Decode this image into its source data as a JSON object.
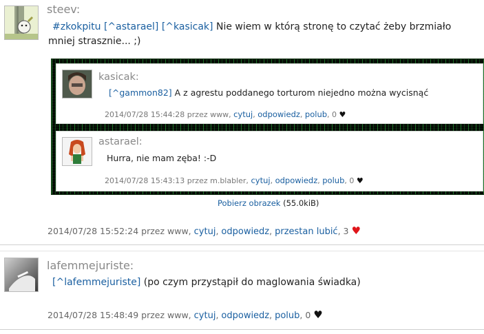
{
  "posts": [
    {
      "author": "steev:",
      "text_parts": {
        "hashtag": "#zkokpitu",
        "mention1": "[^astarael]",
        "mention2": "[^kasicak]",
        "body": " Nie wiem w którą stronę to czytać żeby brzmiało mniej strasznie... ;)"
      },
      "meta": {
        "timestamp": "2014/07/28 15:52:24",
        "via": "przez www,",
        "quote": "cytuj",
        "reply": "odpowiedz",
        "like": "przestan lubić",
        "likes": "3",
        "heart": "♥"
      }
    },
    {
      "author": "lafemmejuriste:",
      "text_parts": {
        "mention": "[^lafemmejuriste]",
        "body": " (po czym przystąpił do maglowania świadka)"
      },
      "meta": {
        "timestamp": "2014/07/28 15:48:49",
        "via": "przez www,",
        "quote": "cytuj",
        "reply": "odpowiedz",
        "like": "polub",
        "likes": "0",
        "heart": "♥"
      }
    }
  ],
  "embedded": {
    "cards": [
      {
        "author": "kasicak:",
        "mention": "[^gammon82]",
        "body": " A z agrestu poddanego torturom niejedno można wycisnąć",
        "meta_prefix": "2014/07/28 15:44:28 przez www,",
        "quote": "cytuj",
        "reply": "odpowiedz",
        "like": "polub",
        "likes": "0",
        "heart": "♥"
      },
      {
        "author": "astarael:",
        "body": "Hurra, nie mam zęba! :-D",
        "meta_prefix": "2014/07/28 15:43:13 przez m.blabler,",
        "quote": "cytuj",
        "reply": "odpowiedz",
        "like": "polub",
        "likes": "0",
        "heart": "♥"
      }
    ],
    "download_label": "Pobierz obrazek",
    "download_size": "(55.0kiB)"
  }
}
